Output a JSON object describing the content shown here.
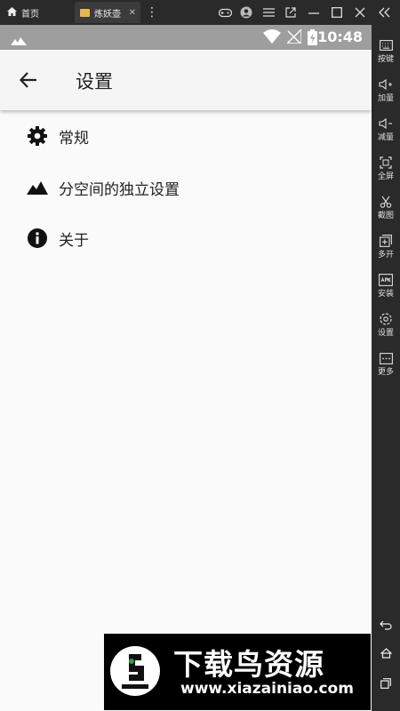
{
  "emulator": {
    "tabs": [
      {
        "label": "首页",
        "icon": "home-icon"
      },
      {
        "label": "炼妖壶",
        "icon": "app-icon"
      }
    ],
    "sidebar": [
      {
        "label": "按键",
        "icon": "keyboard-icon"
      },
      {
        "label": "加量",
        "icon": "volume-up-icon"
      },
      {
        "label": "减量",
        "icon": "volume-down-icon"
      },
      {
        "label": "全屏",
        "icon": "fullscreen-icon"
      },
      {
        "label": "截图",
        "icon": "scissors-icon"
      },
      {
        "label": "多开",
        "icon": "multi-instance-icon"
      },
      {
        "label": "安装",
        "icon": "apk-icon"
      },
      {
        "label": "设置",
        "icon": "gear-icon"
      },
      {
        "label": "更多",
        "icon": "more-icon"
      }
    ]
  },
  "status_bar": {
    "time": "10:48"
  },
  "app_bar": {
    "title": "设置"
  },
  "settings": [
    {
      "label": "常规",
      "icon": "gear-icon"
    },
    {
      "label": "分空间的独立设置",
      "icon": "mountain-icon"
    },
    {
      "label": "关于",
      "icon": "info-icon"
    }
  ],
  "watermark": {
    "title": "下载鸟资源",
    "url": "www.xiazainiao.com"
  },
  "colors": {
    "statusbar": "#9e9e9e",
    "background": "#fafafa",
    "emulator_chrome": "#2a2a2a"
  }
}
